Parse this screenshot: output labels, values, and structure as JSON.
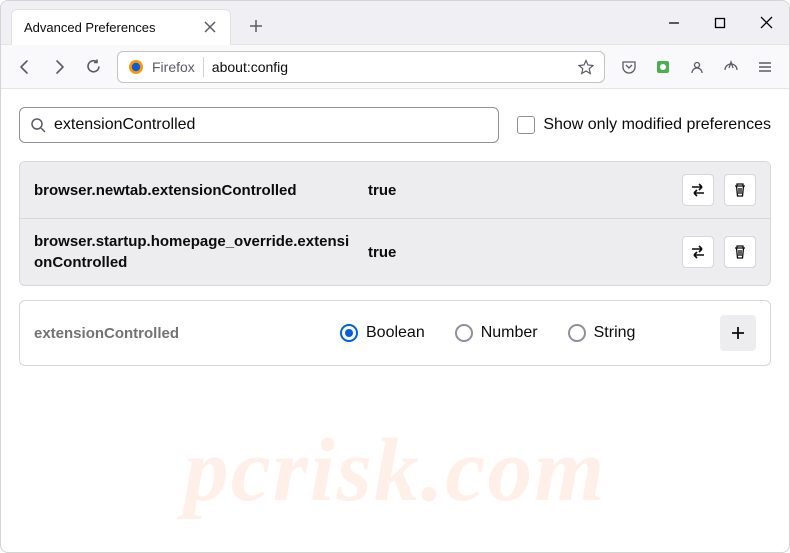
{
  "titlebar": {
    "tabTitle": "Advanced Preferences"
  },
  "addressbar": {
    "label": "Firefox",
    "url": "about:config"
  },
  "search": {
    "value": "extensionControlled",
    "checkboxLabel": "Show only modified preferences"
  },
  "prefs": [
    {
      "name": "browser.newtab.extensionControlled",
      "value": "true"
    },
    {
      "name": "browser.startup.homepage_override.extensionControlled",
      "value": "true"
    }
  ],
  "newPref": {
    "name": "extensionControlled",
    "types": [
      "Boolean",
      "Number",
      "String"
    ],
    "selectedType": "Boolean"
  },
  "watermark": "pcrisk.com"
}
